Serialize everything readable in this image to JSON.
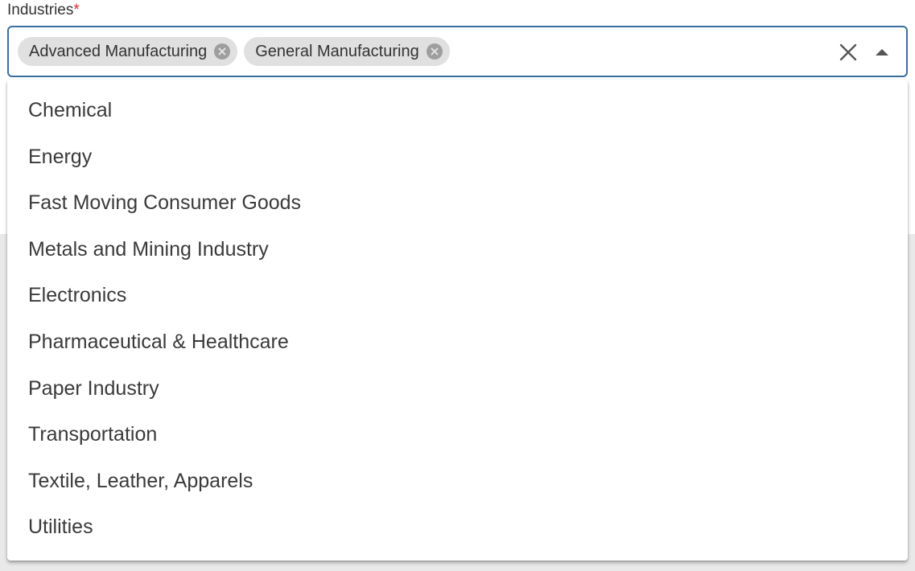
{
  "field": {
    "label": "Industries",
    "required_mark": "*"
  },
  "selected_chips": [
    {
      "label": "Advanced Manufacturing"
    },
    {
      "label": "General Manufacturing"
    }
  ],
  "dropdown": {
    "options": [
      "Chemical",
      "Energy",
      "Fast Moving Consumer Goods",
      "Metals and Mining Industry",
      "Electronics",
      "Pharmaceutical & Healthcare",
      "Paper Industry",
      "Transportation",
      "Textile, Leather, Apparels",
      "Utilities"
    ]
  },
  "icons": {
    "chip_remove": "circle-x-icon",
    "clear": "close-icon",
    "toggle": "caret-up-icon"
  },
  "colors": {
    "focus_border": "#3b6e9c",
    "required": "#d32f2f",
    "chip_bg": "#e0e0e0",
    "chip_remove_bg": "#9e9e9e"
  }
}
